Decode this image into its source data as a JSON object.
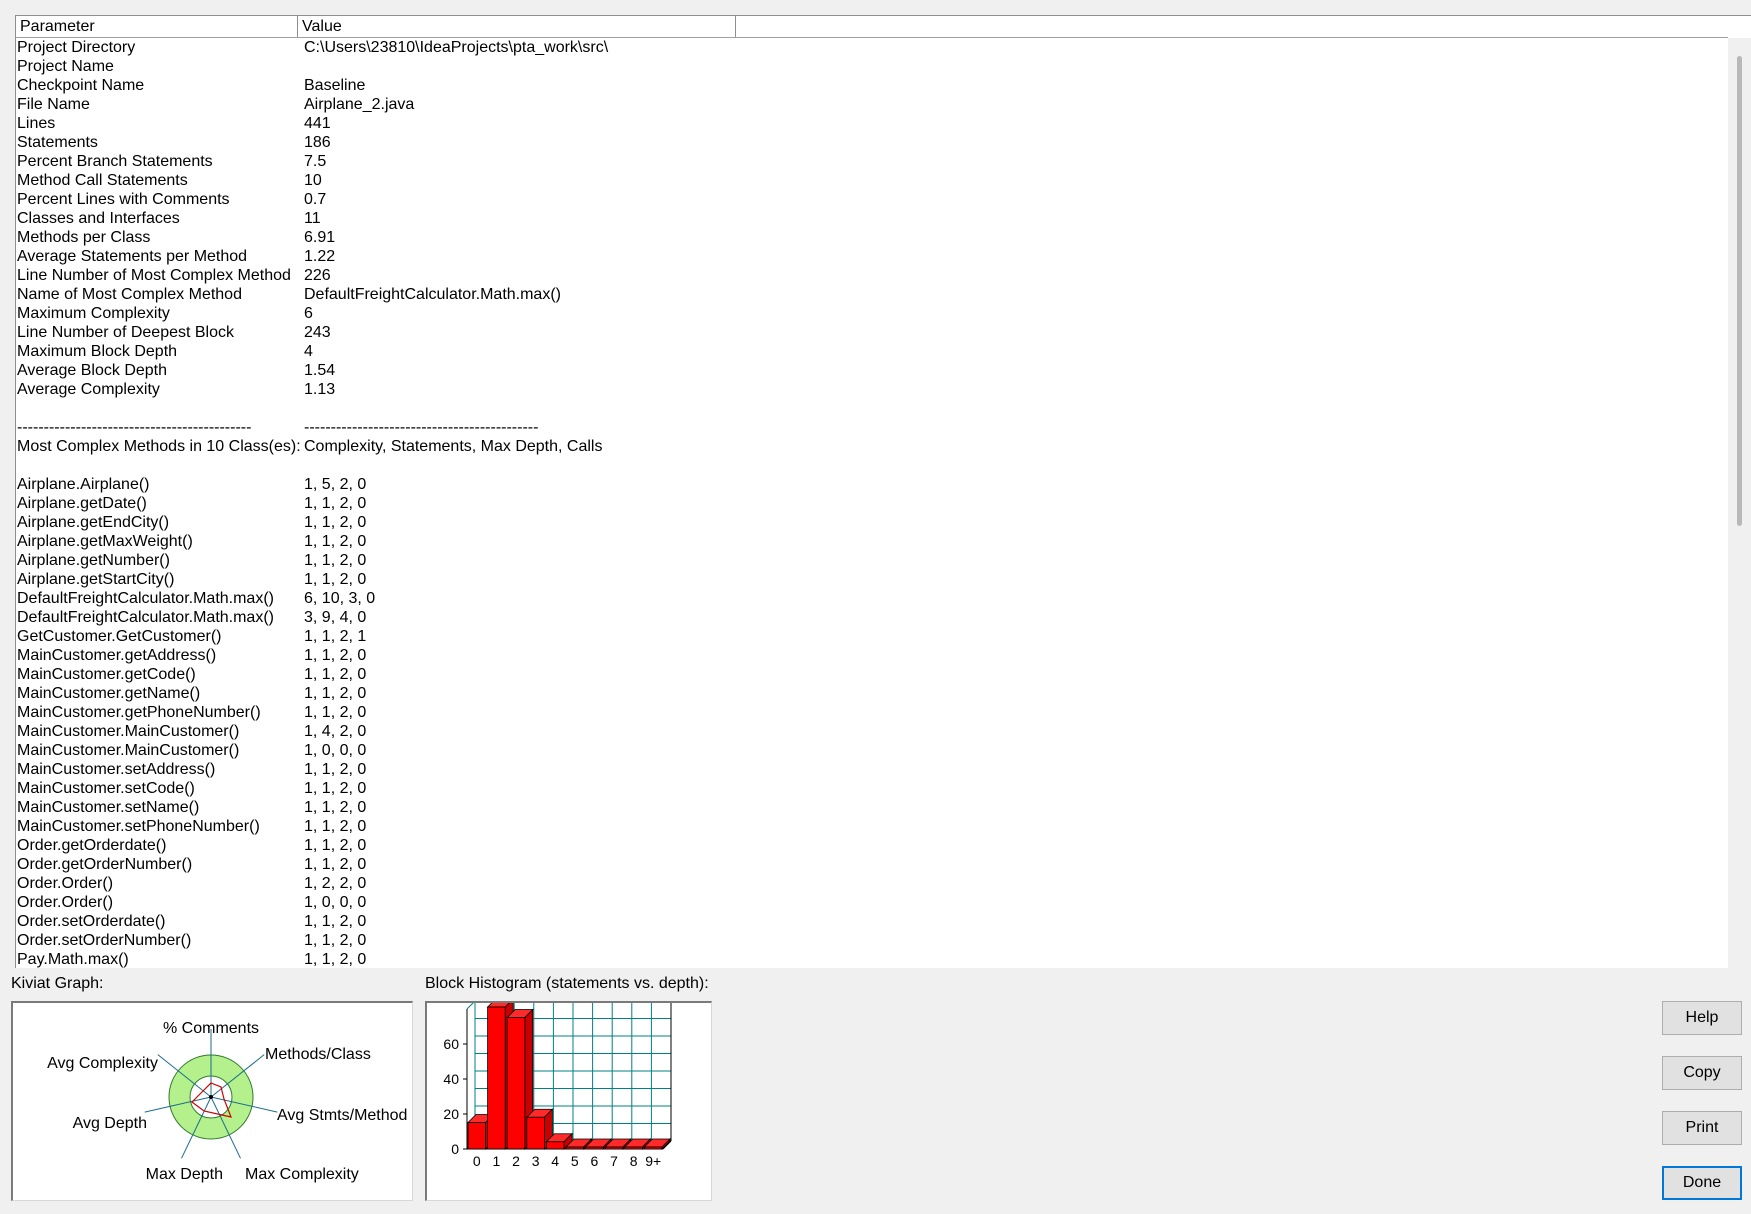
{
  "table": {
    "headers": [
      "Parameter",
      "Value"
    ],
    "rows": [
      [
        "Project Directory",
        "C:\\Users\\23810\\IdeaProjects\\pta_work\\src\\"
      ],
      [
        "Project Name",
        ""
      ],
      [
        "Checkpoint Name",
        "Baseline"
      ],
      [
        "File Name",
        "Airplane_2.java"
      ],
      [
        "Lines",
        "441"
      ],
      [
        "Statements",
        "186"
      ],
      [
        "Percent Branch Statements",
        "7.5"
      ],
      [
        "Method Call Statements",
        "10"
      ],
      [
        "Percent Lines with Comments",
        "0.7"
      ],
      [
        "Classes and Interfaces",
        "11"
      ],
      [
        "Methods per Class",
        "6.91"
      ],
      [
        "Average Statements per Method",
        "1.22"
      ],
      [
        "Line Number of Most Complex Method",
        "226"
      ],
      [
        "Name of Most Complex Method",
        "DefaultFreightCalculator.Math.max()"
      ],
      [
        "Maximum Complexity",
        "6"
      ],
      [
        "Line Number of Deepest Block",
        "243"
      ],
      [
        "Maximum Block Depth",
        "4"
      ],
      [
        "Average Block Depth",
        "1.54"
      ],
      [
        "Average Complexity",
        "1.13"
      ],
      [
        "",
        ""
      ],
      [
        "--------------------------------------------",
        "--------------------------------------------"
      ],
      [
        "Most Complex Methods in 10 Class(es):",
        "Complexity, Statements, Max Depth, Calls"
      ],
      [
        "",
        ""
      ],
      [
        "Airplane.Airplane()",
        "1, 5, 2, 0"
      ],
      [
        "Airplane.getDate()",
        "1, 1, 2, 0"
      ],
      [
        "Airplane.getEndCity()",
        "1, 1, 2, 0"
      ],
      [
        "Airplane.getMaxWeight()",
        "1, 1, 2, 0"
      ],
      [
        "Airplane.getNumber()",
        "1, 1, 2, 0"
      ],
      [
        "Airplane.getStartCity()",
        "1, 1, 2, 0"
      ],
      [
        "DefaultFreightCalculator.Math.max()",
        "6, 10, 3, 0"
      ],
      [
        "DefaultFreightCalculator.Math.max()",
        "3, 9, 4, 0"
      ],
      [
        "GetCustomer.GetCustomer()",
        "1, 1, 2, 1"
      ],
      [
        "MainCustomer.getAddress()",
        "1, 1, 2, 0"
      ],
      [
        "MainCustomer.getCode()",
        "1, 1, 2, 0"
      ],
      [
        "MainCustomer.getName()",
        "1, 1, 2, 0"
      ],
      [
        "MainCustomer.getPhoneNumber()",
        "1, 1, 2, 0"
      ],
      [
        "MainCustomer.MainCustomer()",
        "1, 4, 2, 0"
      ],
      [
        "MainCustomer.MainCustomer()",
        "1, 0, 0, 0"
      ],
      [
        "MainCustomer.setAddress()",
        "1, 1, 2, 0"
      ],
      [
        "MainCustomer.setCode()",
        "1, 1, 2, 0"
      ],
      [
        "MainCustomer.setName()",
        "1, 1, 2, 0"
      ],
      [
        "MainCustomer.setPhoneNumber()",
        "1, 1, 2, 0"
      ],
      [
        "Order.getOrderdate()",
        "1, 1, 2, 0"
      ],
      [
        "Order.getOrderNumber()",
        "1, 1, 2, 0"
      ],
      [
        "Order.Order()",
        "1, 2, 2, 0"
      ],
      [
        "Order.Order()",
        "1, 0, 0, 0"
      ],
      [
        "Order.setOrderdate()",
        "1, 1, 2, 0"
      ],
      [
        "Order.setOrderNumber()",
        "1, 1, 2, 0"
      ],
      [
        "Pay.Math.max()",
        "1, 1, 2, 0"
      ]
    ]
  },
  "kiviat": {
    "label": "Kiviat Graph:",
    "axes": [
      "% Comments",
      "Methods/Class",
      "Avg Stmts/Method",
      "Max Complexity",
      "Max Depth",
      "Avg Depth",
      "Avg Complexity"
    ]
  },
  "histogram": {
    "label": "Block Histogram (statements vs. depth):"
  },
  "chart_data": {
    "type": "bar",
    "categories": [
      "0",
      "1",
      "2",
      "3",
      "4",
      "5",
      "6",
      "7",
      "8",
      "9+"
    ],
    "values": [
      14,
      80,
      74,
      17,
      3,
      0,
      0,
      0,
      0,
      0
    ],
    "ylim": [
      0,
      80
    ],
    "yticks": [
      0,
      20,
      40,
      60
    ],
    "grid": true,
    "bar_color": "#ff0000",
    "grid_color": "#008080"
  },
  "buttons": {
    "help": "Help",
    "copy": "Copy",
    "print": "Print",
    "done": "Done"
  }
}
